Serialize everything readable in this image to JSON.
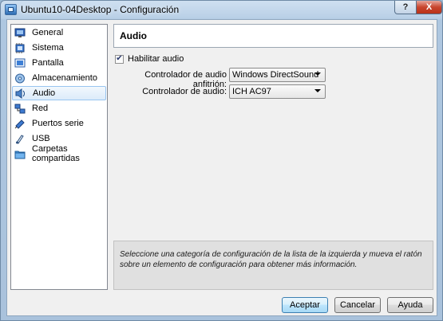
{
  "window": {
    "title": "Ubuntu10-04Desktop - Configuración",
    "help_label": "?",
    "close_label": "X"
  },
  "sidebar": {
    "items": [
      {
        "label": "General",
        "icon": "general-icon"
      },
      {
        "label": "Sistema",
        "icon": "system-icon"
      },
      {
        "label": "Pantalla",
        "icon": "display-icon"
      },
      {
        "label": "Almacenamiento",
        "icon": "storage-icon"
      },
      {
        "label": "Audio",
        "icon": "audio-icon",
        "selected": true
      },
      {
        "label": "Red",
        "icon": "network-icon"
      },
      {
        "label": "Puertos serie",
        "icon": "serial-ports-icon"
      },
      {
        "label": "USB",
        "icon": "usb-icon"
      },
      {
        "label": "Carpetas compartidas",
        "icon": "shared-folders-icon"
      }
    ]
  },
  "panel": {
    "title": "Audio",
    "enable_audio": {
      "label": "Habilitar audio",
      "checked": true,
      "mark": "✔"
    },
    "host_driver": {
      "label": "Controlador de audio anfitrión:",
      "value": "Windows DirectSound"
    },
    "controller": {
      "label": "Controlador de audio:",
      "value": "ICH AC97"
    }
  },
  "info": {
    "text": "Seleccione una categoría de configuración de la lista de la izquierda y mueva el ratón sobre un elemento de configuración para obtener más información."
  },
  "buttons": {
    "accept": "Aceptar",
    "cancel": "Cancelar",
    "help": "Ayuda"
  }
}
